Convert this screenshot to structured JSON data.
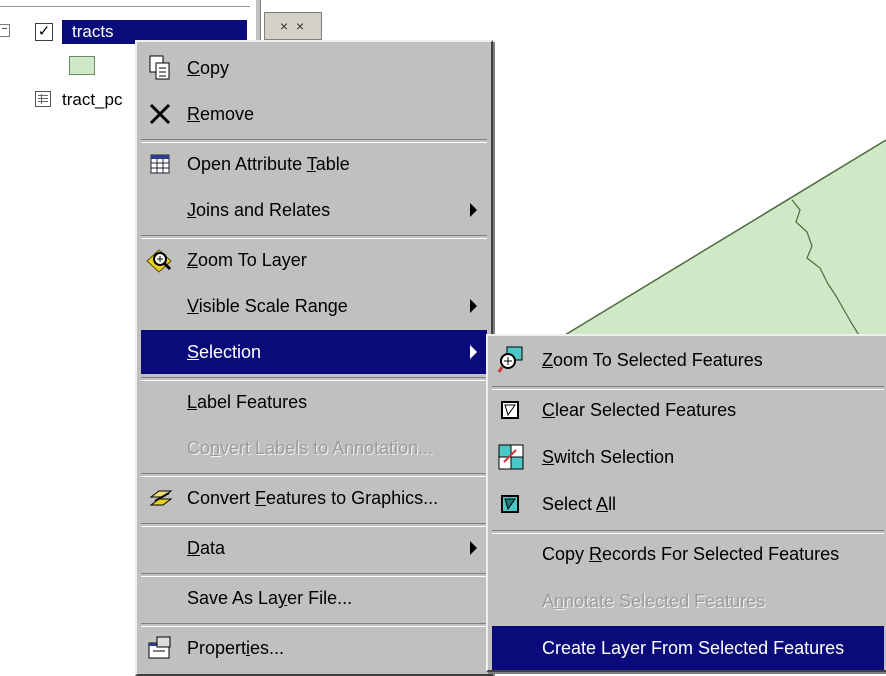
{
  "toc": {
    "layer": {
      "label": "tracts",
      "checked": true
    },
    "table_item": {
      "label": "tract_pc"
    }
  },
  "toolbar": {
    "button_glyph": "× ×"
  },
  "context_menu": {
    "items": [
      {
        "label_pre": "",
        "label_key": "C",
        "label_post": "opy",
        "icon": "copy-icon"
      },
      {
        "label_pre": "",
        "label_key": "R",
        "label_post": "emove",
        "icon": "remove-icon"
      },
      {
        "label_pre": "Open Attribute ",
        "label_key": "T",
        "label_post": "able",
        "icon": "attribute-table-icon"
      },
      {
        "label_pre": "",
        "label_key": "J",
        "label_post": "oins and Relates",
        "submenu": true
      },
      {
        "label_pre": "",
        "label_key": "Z",
        "label_post": "oom To Layer",
        "icon": "zoom-to-layer-icon"
      },
      {
        "label_pre": "",
        "label_key": "V",
        "label_post": "isible Scale Range",
        "submenu": true
      },
      {
        "label_pre": "",
        "label_key": "S",
        "label_post": "election",
        "submenu": true,
        "selected": true
      },
      {
        "label_pre": "",
        "label_key": "L",
        "label_post": "abel Features"
      },
      {
        "label_pre": "Co",
        "label_key": "n",
        "label_post": "vert Labels to Annotation...",
        "disabled": true
      },
      {
        "label_pre": "Convert ",
        "label_key": "F",
        "label_post": "eatures to Graphics...",
        "icon": "convert-graphics-icon"
      },
      {
        "label_pre": "",
        "label_key": "D",
        "label_post": "ata",
        "submenu": true
      },
      {
        "label_pre": "Save As La",
        "label_key": "y",
        "label_post": "er File..."
      },
      {
        "label_pre": "Propert",
        "label_key": "i",
        "label_post": "es...",
        "icon": "properties-icon"
      }
    ]
  },
  "selection_submenu": {
    "items": [
      {
        "label_pre": "",
        "label_key": "Z",
        "label_post": "oom To Selected Features",
        "icon": "zoom-selected-icon"
      },
      {
        "label_pre": "",
        "label_key": "C",
        "label_post": "lear Selected Features",
        "icon": "clear-selection-icon"
      },
      {
        "label_pre": "",
        "label_key": "S",
        "label_post": "witch Selection",
        "icon": "switch-selection-icon"
      },
      {
        "label_pre": "Select ",
        "label_key": "A",
        "label_post": "ll",
        "icon": "select-all-icon"
      },
      {
        "label_pre": "Copy ",
        "label_key": "R",
        "label_post": "ecords For Selected Features"
      },
      {
        "label_pre": "A",
        "label_key": "n",
        "label_post": "notate Selected Features",
        "disabled": true
      },
      {
        "label_pre": "Create Layer From Selected Features",
        "label_key": "",
        "label_post": "",
        "selected": true
      }
    ]
  },
  "colors": {
    "highlight": "#0a0a7a",
    "menu_face": "#c0c0c0",
    "map_fill": "#cfe8c6",
    "boundary": "#4e6b3e"
  }
}
